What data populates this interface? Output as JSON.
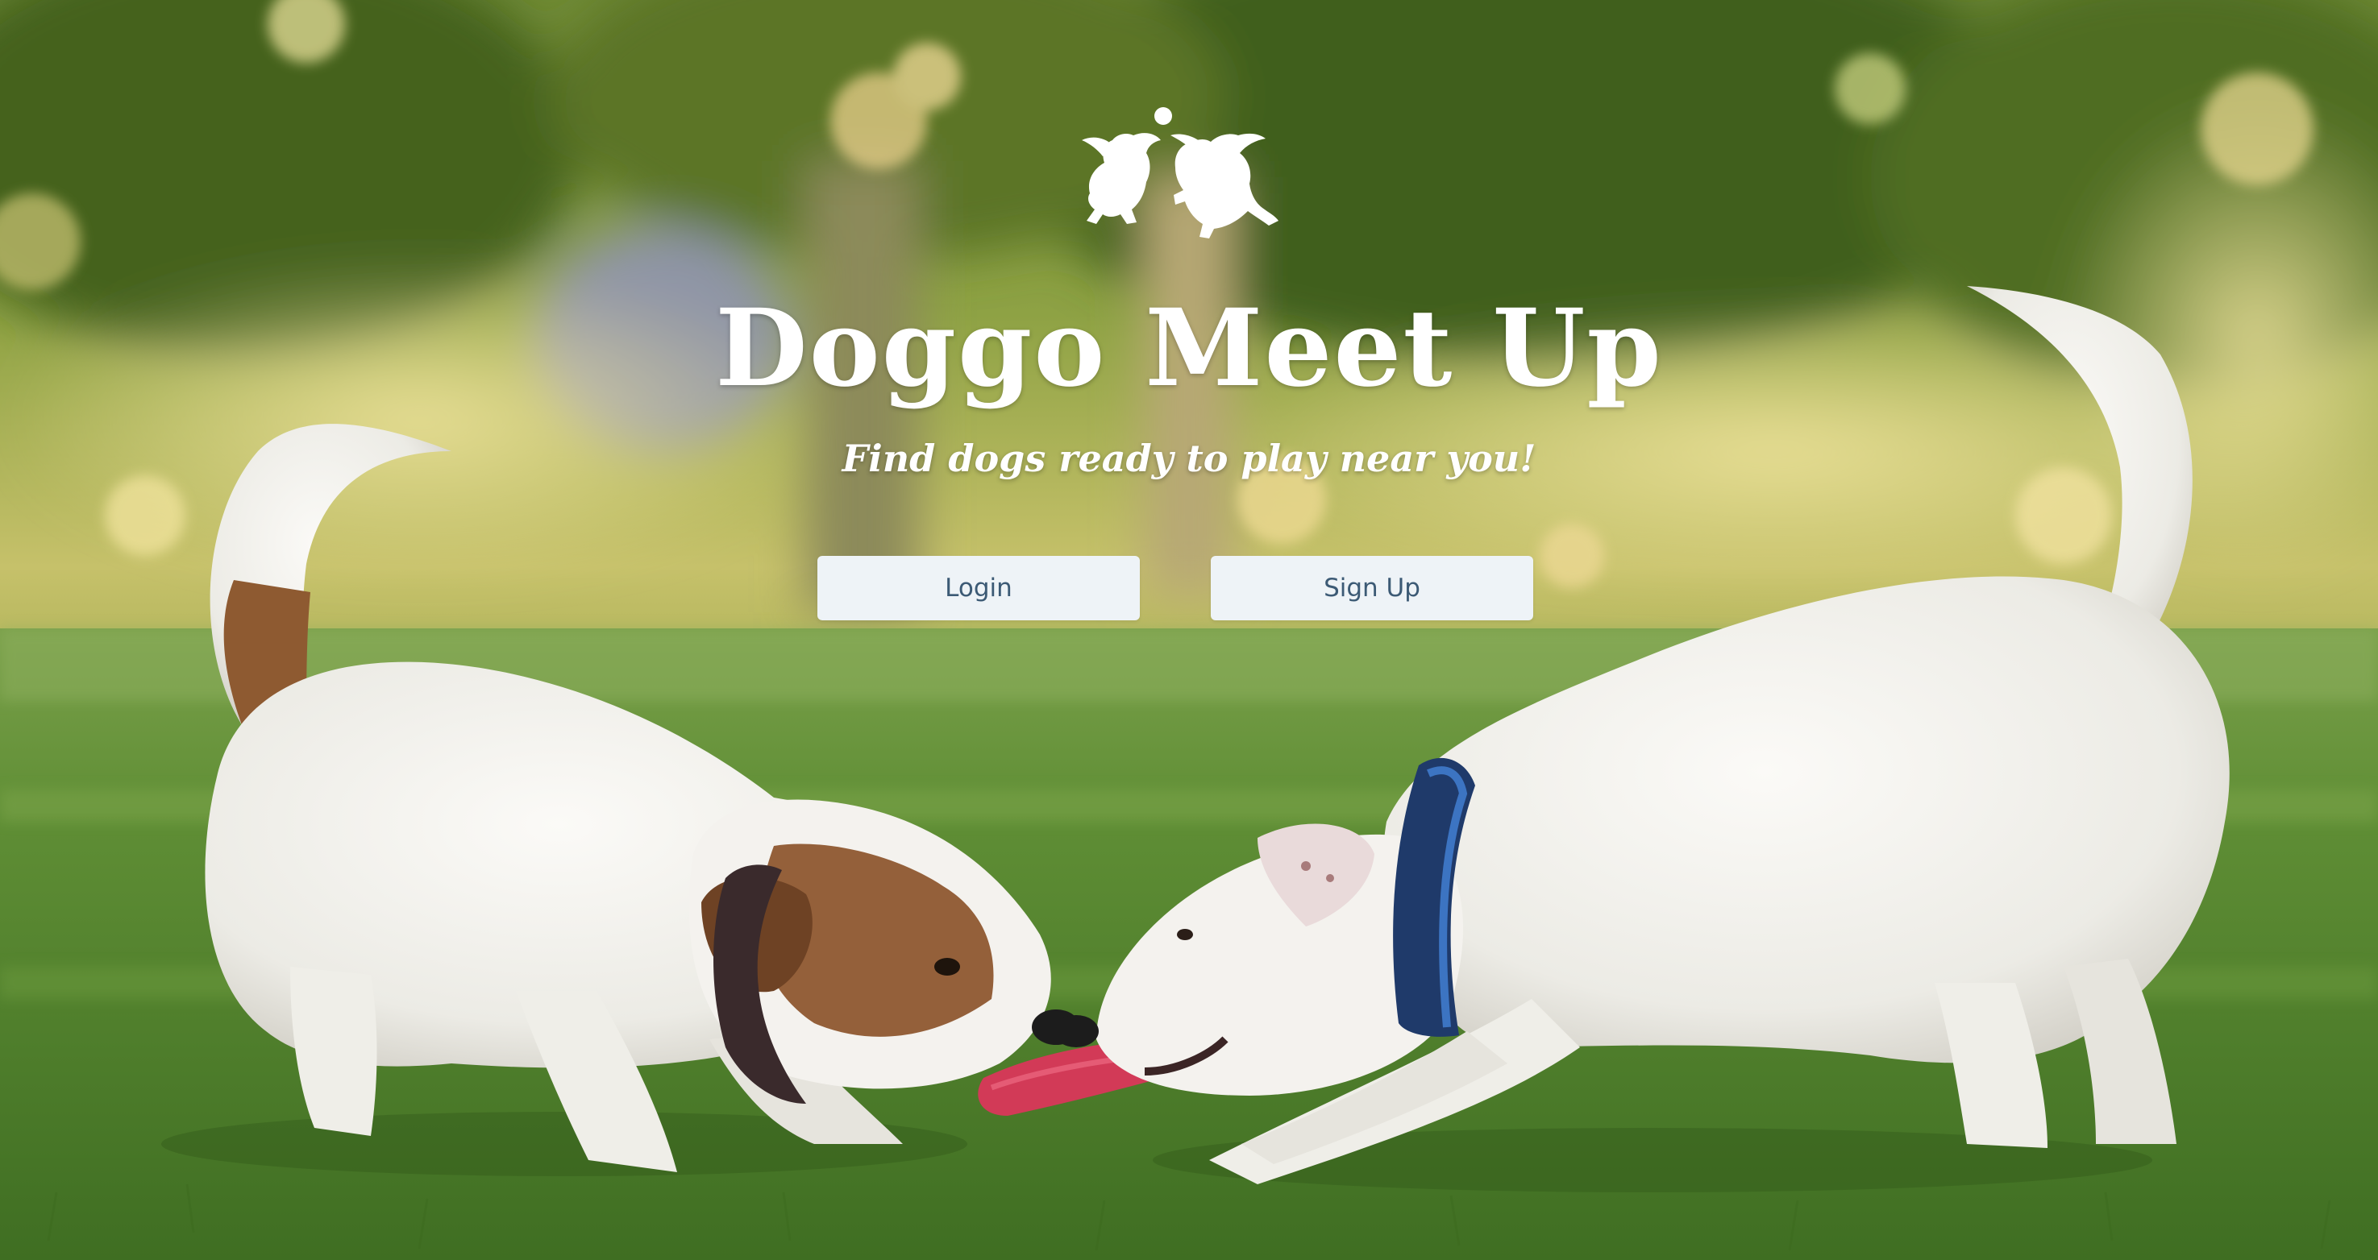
{
  "hero": {
    "title": "Doggo Meet Up",
    "subtitle": "Find dogs ready to play near you!",
    "logo_icon": "two-dogs-playing-ball-icon"
  },
  "actions": {
    "login_label": "Login",
    "signup_label": "Sign Up"
  },
  "background": {
    "scene": "two-dogs-tug-of-war-on-grass-photo",
    "colors": {
      "sky_light": "#d9d58a",
      "foliage": "#5f7a2c",
      "grass": "#5a8a2f",
      "dog_white": "#f1efeb",
      "dog_brown": "#8b5a34",
      "toy_red": "#d23a57",
      "collar_blue": "#1f3a6a"
    }
  },
  "colors": {
    "button_bg": "#eef3f7",
    "button_text": "#3c5a75",
    "title_text": "#ffffff"
  }
}
